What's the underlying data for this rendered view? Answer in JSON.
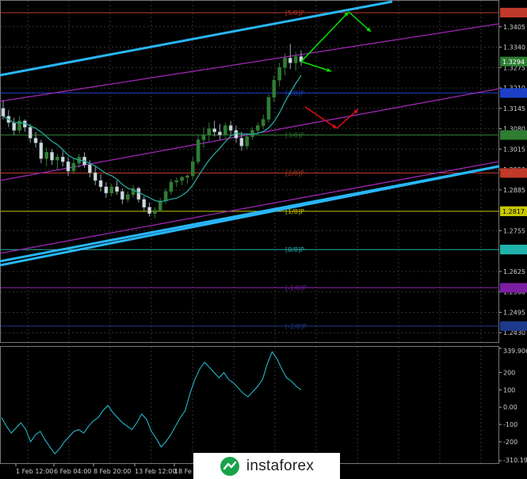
{
  "chart_data": {
    "type": "candlestick",
    "price_axis": {
      "ticks": [
        "1.3405",
        "1.3340",
        "1.3275",
        "1.3210",
        "1.3145",
        "1.3080",
        "1.3015",
        "1.2950",
        "1.2885",
        "1.2755",
        "1.2625",
        "1.2560",
        "1.2495",
        "1.2430",
        "1.2365"
      ],
      "ylim": [
        1.2365,
        1.3465
      ]
    },
    "time_axis": {
      "ticks": [
        "1 Feb 12:00",
        "6 Feb 04:00",
        "8 Feb 20:00",
        "13 Feb 12:00",
        "18 Fe"
      ]
    },
    "price_badges": [
      {
        "label": "1.3294",
        "price": 1.3294,
        "color": "#2e7d32"
      },
      {
        "label": "1.2817",
        "price": 1.2817,
        "color": "#c8c800"
      }
    ],
    "murrey_levels": [
      {
        "label": "[5/8]P",
        "price": 1.345,
        "color": "#c0392b"
      },
      {
        "label": "[4/8]P",
        "price": 1.3194,
        "color": "#1e40c8"
      },
      {
        "label": "[3/8]P",
        "price": 1.306,
        "color": "#2e7d32"
      },
      {
        "label": "[2/8]P",
        "price": 1.2939,
        "color": "#c0392b"
      },
      {
        "label": "[1/8]P",
        "price": 1.2817,
        "color": "#c8c800"
      },
      {
        "label": "[0/8]P",
        "price": 1.2695,
        "color": "#20b2aa"
      },
      {
        "label": "[-1/8]P",
        "price": 1.2573,
        "color": "#7b1fa2"
      },
      {
        "label": "[-2/8]P",
        "price": 1.2451,
        "color": "#1e3a8a"
      }
    ],
    "ohlc": [
      [
        1.3145,
        1.317,
        1.311,
        1.312
      ],
      [
        1.312,
        1.314,
        1.3085,
        1.31
      ],
      [
        1.31,
        1.3115,
        1.306,
        1.3075
      ],
      [
        1.3075,
        1.312,
        1.3065,
        1.3105
      ],
      [
        1.3105,
        1.311,
        1.307,
        1.3085
      ],
      [
        1.3085,
        1.3095,
        1.3035,
        1.305
      ],
      [
        1.305,
        1.307,
        1.302,
        1.3035
      ],
      [
        1.3035,
        1.3045,
        1.297,
        1.2985
      ],
      [
        1.2985,
        1.302,
        1.296,
        1.3005
      ],
      [
        1.3005,
        1.3015,
        1.2965,
        1.298
      ],
      [
        1.298,
        1.3,
        1.295,
        1.299
      ],
      [
        1.299,
        1.301,
        1.296,
        1.2975
      ],
      [
        1.2975,
        1.299,
        1.293,
        1.2945
      ],
      [
        1.2945,
        1.2985,
        1.2935,
        1.297
      ],
      [
        1.297,
        1.3,
        1.2955,
        1.299
      ],
      [
        1.299,
        1.3005,
        1.2955,
        1.2965
      ],
      [
        1.2965,
        1.298,
        1.2925,
        1.294
      ],
      [
        1.294,
        1.296,
        1.29,
        1.2915
      ],
      [
        1.2915,
        1.2935,
        1.288,
        1.2895
      ],
      [
        1.2895,
        1.291,
        1.286,
        1.2875
      ],
      [
        1.2875,
        1.2905,
        1.2865,
        1.2895
      ],
      [
        1.2895,
        1.2915,
        1.287,
        1.288
      ],
      [
        1.288,
        1.289,
        1.284,
        1.2855
      ],
      [
        1.2855,
        1.288,
        1.2845,
        1.287
      ],
      [
        1.287,
        1.29,
        1.286,
        1.289
      ],
      [
        1.289,
        1.2895,
        1.2845,
        1.2855
      ],
      [
        1.2855,
        1.2865,
        1.2815,
        1.283
      ],
      [
        1.283,
        1.2845,
        1.28,
        1.281
      ],
      [
        1.281,
        1.283,
        1.2795,
        1.282
      ],
      [
        1.282,
        1.286,
        1.2815,
        1.285
      ],
      [
        1.285,
        1.289,
        1.284,
        1.288
      ],
      [
        1.288,
        1.292,
        1.287,
        1.291
      ],
      [
        1.291,
        1.2925,
        1.2895,
        1.2915
      ],
      [
        1.2915,
        1.293,
        1.29,
        1.2925
      ],
      [
        1.2925,
        1.2935,
        1.2905,
        1.293
      ],
      [
        1.293,
        1.299,
        1.292,
        1.2975
      ],
      [
        1.2975,
        1.306,
        1.2965,
        1.3045
      ],
      [
        1.3045,
        1.3085,
        1.302,
        1.306
      ],
      [
        1.306,
        1.31,
        1.304,
        1.308
      ],
      [
        1.308,
        1.3105,
        1.3055,
        1.307
      ],
      [
        1.307,
        1.3095,
        1.3045,
        1.306
      ],
      [
        1.306,
        1.31,
        1.305,
        1.309
      ],
      [
        1.309,
        1.3105,
        1.306,
        1.3075
      ],
      [
        1.3075,
        1.309,
        1.3035,
        1.305
      ],
      [
        1.305,
        1.307,
        1.301,
        1.3025
      ],
      [
        1.3025,
        1.306,
        1.3015,
        1.3055
      ],
      [
        1.3055,
        1.3085,
        1.3045,
        1.3075
      ],
      [
        1.3075,
        1.31,
        1.306,
        1.309
      ],
      [
        1.309,
        1.3125,
        1.308,
        1.311
      ],
      [
        1.311,
        1.319,
        1.31,
        1.318
      ],
      [
        1.318,
        1.325,
        1.3165,
        1.3235
      ],
      [
        1.3235,
        1.329,
        1.3215,
        1.3275
      ],
      [
        1.3275,
        1.332,
        1.325,
        1.3305
      ],
      [
        1.3305,
        1.335,
        1.327,
        1.329
      ],
      [
        1.329,
        1.3325,
        1.3265,
        1.331
      ],
      [
        1.331,
        1.333,
        1.328,
        1.3294
      ]
    ],
    "indicator": {
      "ticks": [
        "339.9066",
        "200",
        "100",
        "0.00",
        "-100",
        "-200",
        "-310.194"
      ],
      "ylim": [
        -310.194,
        339.9066
      ],
      "values": [
        -60,
        -110,
        -150,
        -120,
        -90,
        -130,
        -200,
        -160,
        -140,
        -190,
        -230,
        -270,
        -240,
        -200,
        -170,
        -140,
        -130,
        -150,
        -110,
        -80,
        -60,
        -20,
        10,
        -30,
        -60,
        -90,
        -110,
        -130,
        -90,
        -40,
        -70,
        -140,
        -180,
        -230,
        -200,
        -160,
        -110,
        -60,
        -20,
        80,
        160,
        220,
        260,
        230,
        200,
        170,
        200,
        160,
        140,
        110,
        80,
        60,
        90,
        120,
        160,
        250,
        320,
        280,
        220,
        170,
        150,
        120,
        100
      ]
    },
    "annotations": [
      "green projection arrows up from 1.3294",
      "red projection arrow down toward 1.3080"
    ]
  },
  "brand": {
    "name": "instaforex"
  }
}
